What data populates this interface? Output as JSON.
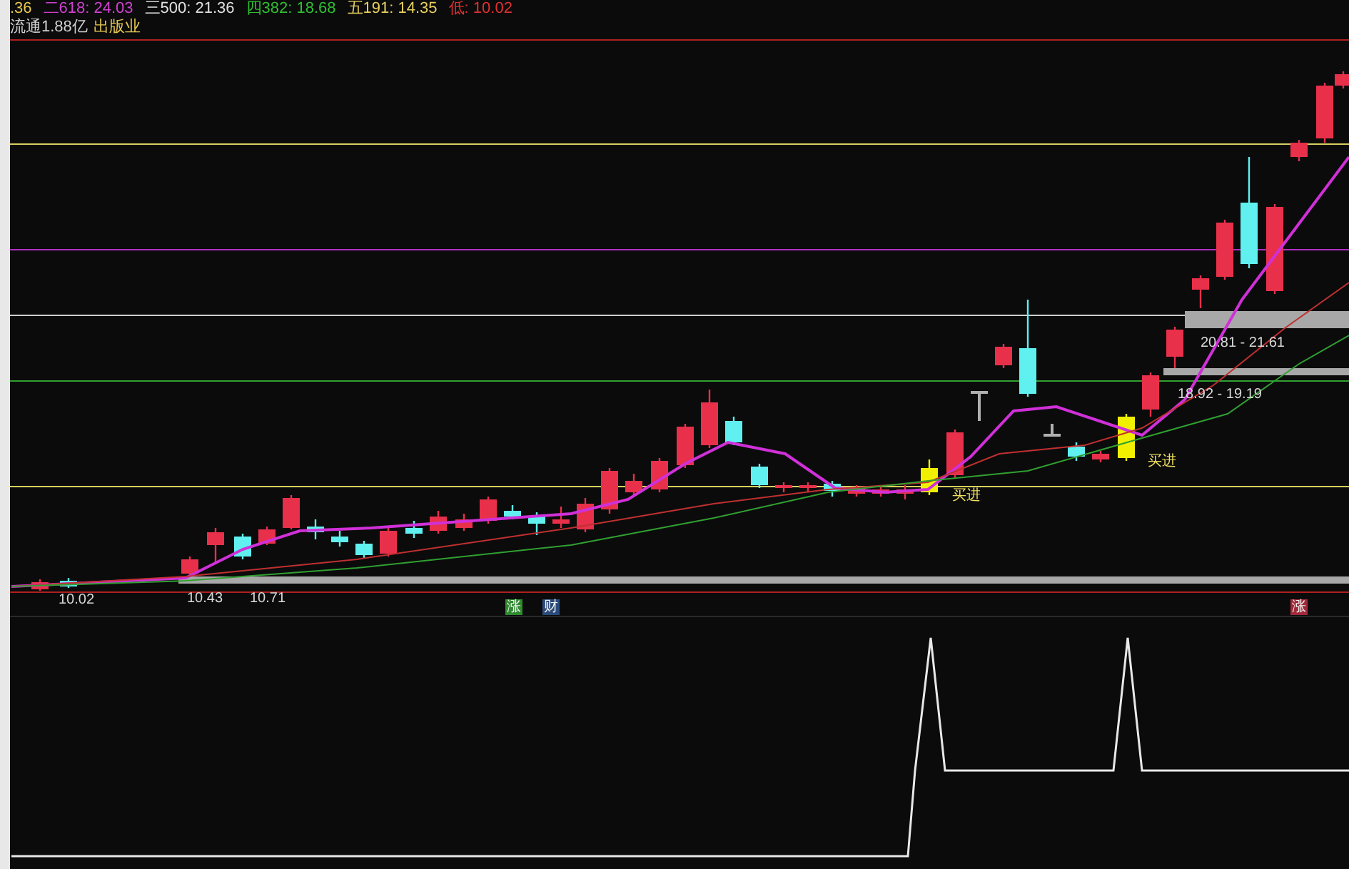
{
  "header": [
    {
      "text": ".36",
      "color": "#e8c850"
    },
    {
      "text": "二618: 24.03",
      "color": "#d040d0"
    },
    {
      "text": "三500: 21.36",
      "color": "#e0e0e0"
    },
    {
      "text": "四382: 18.68",
      "color": "#30c030"
    },
    {
      "text": "五191: 14.35",
      "color": "#e8d060"
    },
    {
      "text": "低: 10.02",
      "color": "#e03030"
    }
  ],
  "info": [
    {
      "text": "流通1.88亿",
      "color": "#d0d0d0"
    },
    {
      "text": "出版业",
      "color": "#e8c850"
    }
  ],
  "price_labels": [
    "20.81 - 21.61",
    "18.92 - 19.19",
    "10.02",
    "10.43",
    "10.71"
  ],
  "signals": [
    "买进",
    "买进"
  ],
  "markers": [
    {
      "text": "涨",
      "color": "#2e8b2e"
    },
    {
      "text": "财",
      "color": "#2a4a7a"
    },
    {
      "text": "涨",
      "color": "#a02a3a"
    }
  ]
}
